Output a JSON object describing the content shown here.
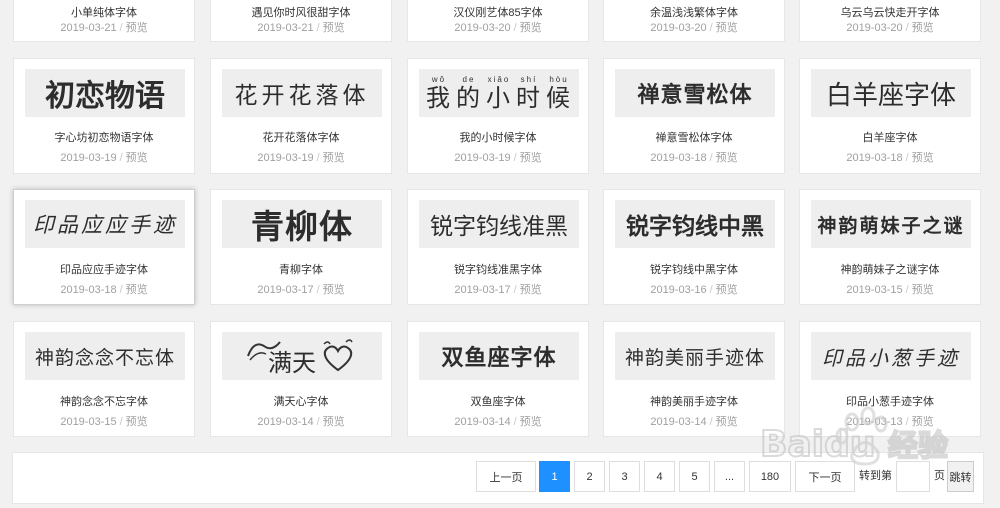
{
  "cards": [
    {
      "name": "小单纯体字体",
      "date": "2019-03-21",
      "preview_link": "预览",
      "preview_text": ""
    },
    {
      "name": "遇见你时风很甜字体",
      "date": "2019-03-21",
      "preview_link": "预览",
      "preview_text": ""
    },
    {
      "name": "汉仪刚艺体85字体",
      "date": "2019-03-20",
      "preview_link": "预览",
      "preview_text": ""
    },
    {
      "name": "余温浅浅繁体字体",
      "date": "2019-03-20",
      "preview_link": "预览",
      "preview_text": ""
    },
    {
      "name": "乌云乌云快走开字体",
      "date": "2019-03-20",
      "preview_link": "预览",
      "preview_text": ""
    },
    {
      "name": "字心坊初恋物语字体",
      "date": "2019-03-19",
      "preview_link": "预览",
      "preview_text": "初恋物语"
    },
    {
      "name": "花开花落体字体",
      "date": "2019-03-19",
      "preview_link": "预览",
      "preview_text": "花开花落体"
    },
    {
      "name": "我的小时候字体",
      "date": "2019-03-19",
      "preview_link": "预览",
      "preview_text": "我的小时候",
      "pinyin": [
        "wǒ",
        "de",
        "xiǎo",
        "shí",
        "hòu"
      ]
    },
    {
      "name": "禅意雪松体字体",
      "date": "2019-03-18",
      "preview_link": "预览",
      "preview_text": "禅意雪松体"
    },
    {
      "name": "白羊座字体",
      "date": "2019-03-18",
      "preview_link": "预览",
      "preview_text": "白羊座字体"
    },
    {
      "name": "印品应应手迹字体",
      "date": "2019-03-18",
      "preview_link": "预览",
      "preview_text": "印品应应手迹"
    },
    {
      "name": "青柳字体",
      "date": "2019-03-17",
      "preview_link": "预览",
      "preview_text": "青柳体"
    },
    {
      "name": "锐字钧线准黑字体",
      "date": "2019-03-17",
      "preview_link": "预览",
      "preview_text": "锐字钧线准黑"
    },
    {
      "name": "锐字钧线中黑字体",
      "date": "2019-03-16",
      "preview_link": "预览",
      "preview_text": "锐字钧线中黑"
    },
    {
      "name": "神韵萌妹子之谜字体",
      "date": "2019-03-15",
      "preview_link": "预览",
      "preview_text": "神韵萌妹子之谜"
    },
    {
      "name": "神韵念念不忘字体",
      "date": "2019-03-15",
      "preview_link": "预览",
      "preview_text": "神韵念念不忘体"
    },
    {
      "name": "满天心字体",
      "date": "2019-03-14",
      "preview_link": "预览",
      "preview_text": "满天"
    },
    {
      "name": "双鱼座字体",
      "date": "2019-03-14",
      "preview_link": "预览",
      "preview_text": "双鱼座字体"
    },
    {
      "name": "神韵美丽手迹字体",
      "date": "2019-03-14",
      "preview_link": "预览",
      "preview_text": "神韵美丽手迹体"
    },
    {
      "name": "印品小葱手迹字体",
      "date": "2019-03-13",
      "preview_link": "预览",
      "preview_text": "印品小葱手迹"
    }
  ],
  "pagination": {
    "prev": "上一页",
    "pages": [
      "1",
      "2",
      "3",
      "4",
      "5"
    ],
    "current": "1",
    "ellipsis": "...",
    "last": "180",
    "next": "下一页",
    "goto_label": "转到第",
    "goto_value": "",
    "page_unit": "页",
    "goto_button": "跳转"
  },
  "watermark": {
    "text": "Baidu",
    "suffix": "经验"
  },
  "colors": {
    "accent": "#1e90ff",
    "background": "#f1f1f1",
    "card": "#ffffff"
  }
}
